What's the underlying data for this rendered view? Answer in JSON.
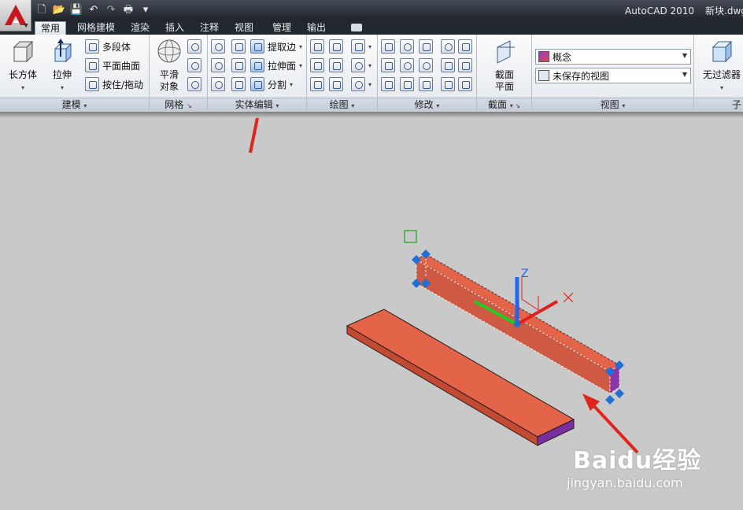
{
  "window": {
    "app_name": "AutoCAD 2010",
    "file_name": "新块.dwg"
  },
  "quick_access": [
    "new-icon",
    "open-icon",
    "save-icon",
    "undo-icon",
    "redo-icon",
    "plot-icon",
    "qat-menu-icon"
  ],
  "tabs": [
    {
      "label": "常用",
      "active": true
    },
    {
      "label": "网格建模"
    },
    {
      "label": "渲染"
    },
    {
      "label": "插入"
    },
    {
      "label": "注释"
    },
    {
      "label": "视图"
    },
    {
      "label": "管理"
    },
    {
      "label": "输出"
    }
  ],
  "panels": {
    "modeling": {
      "title": "建模",
      "box": "长方体",
      "extrude": "拉伸",
      "polysolid": "多段体",
      "planar_surface": "平面曲面",
      "presspull": "按住/拖动"
    },
    "mesh": {
      "title": "网格",
      "smooth_line1": "平滑",
      "smooth_line2": "对象"
    },
    "solid_editing": {
      "title": "实体编辑",
      "extract_edges": "提取边",
      "extrude_faces": "拉伸面",
      "separate": "分割"
    },
    "draw": {
      "title": "绘图"
    },
    "modify": {
      "title": "修改"
    },
    "section": {
      "title": "截面",
      "plane_line1": "截面",
      "plane_line2": "平面"
    },
    "view": {
      "title": "视图",
      "visual_style": "概念",
      "saved_view": "未保存的视图"
    },
    "filter": {
      "label": "无过滤器",
      "title_partial": "子"
    }
  },
  "viewport": {
    "ucs_z_label": "Z",
    "ucs_x_label": "X"
  },
  "watermark": {
    "brand": "Baidu经验",
    "url": "jingyan.baidu.com"
  },
  "colors": {
    "solid_face": "#e4644a",
    "solid_side": "#c24a33",
    "solid_end": "#7a2fa0",
    "grip": "#1f6fd6",
    "annotation_arrow": "#e0251c",
    "axis_x": "#e02020",
    "axis_y": "#22cc22",
    "axis_z": "#2266ee"
  }
}
